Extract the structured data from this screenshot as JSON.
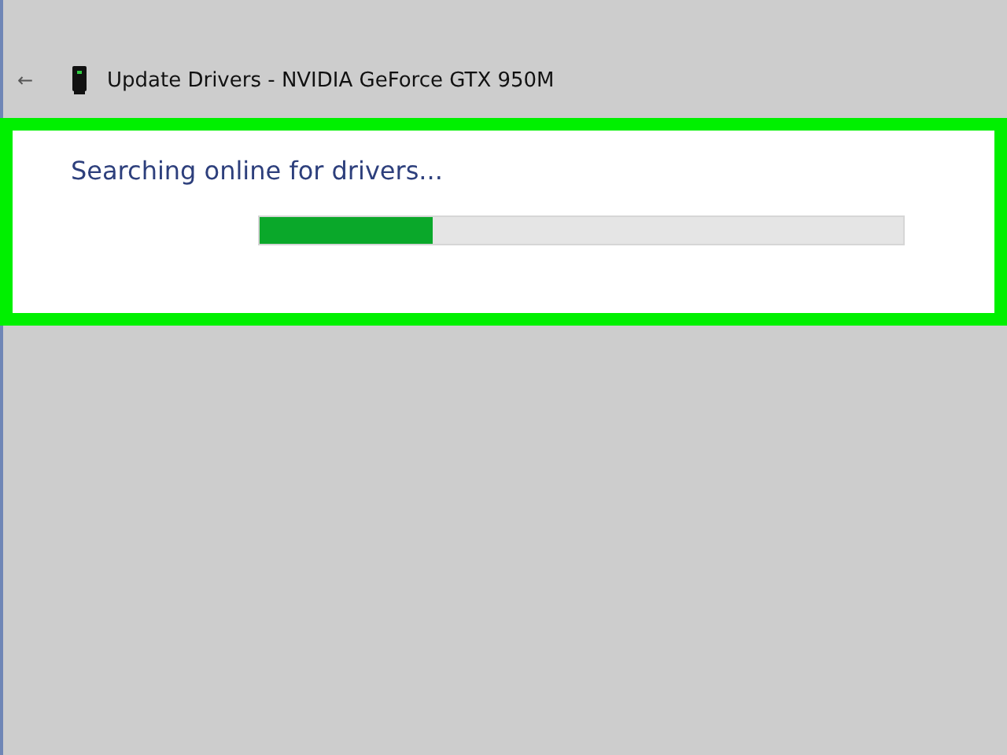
{
  "header": {
    "back": "←",
    "title": "Update Drivers - NVIDIA GeForce GTX 950M"
  },
  "panel": {
    "highlighted": true,
    "status": "Searching online for drivers...",
    "progress": {
      "level": 0.27
    }
  }
}
